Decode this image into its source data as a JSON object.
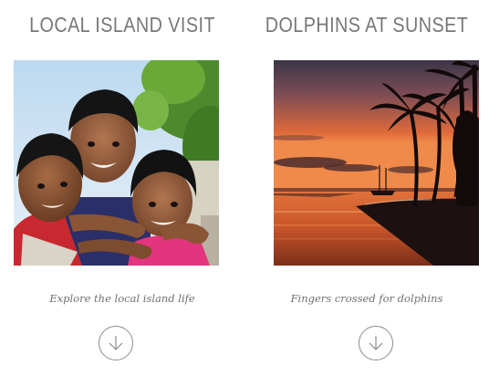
{
  "cards": [
    {
      "title": "LOCAL ISLAND VISIT",
      "image_subject": "three smiling children hugging outdoors",
      "caption": "Explore the local island life",
      "button_icon": "arrow-down-circle-icon"
    },
    {
      "title": "DOLPHINS AT SUNSET",
      "image_subject": "orange sunset over sea with palm trees and sailboat",
      "caption": "Fingers crossed for dolphins",
      "button_icon": "arrow-down-circle-icon"
    }
  ],
  "colors": {
    "title": "#777777",
    "caption": "#6f6f6f",
    "button_border": "#8c8c8c",
    "sunset_sky_top": "#3b3648",
    "sunset_glow": "#f07a3a",
    "sea": "#c9562a"
  }
}
